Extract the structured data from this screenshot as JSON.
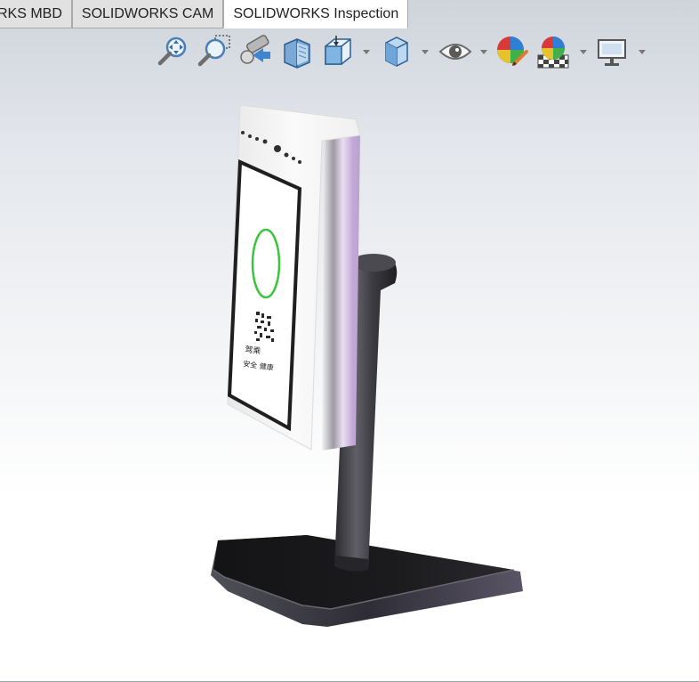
{
  "tabs": [
    {
      "label": "RKS MBD",
      "active": false
    },
    {
      "label": "SOLIDWORKS CAM",
      "active": false
    },
    {
      "label": "SOLIDWORKS Inspection",
      "active": true
    }
  ],
  "toolbar": {
    "icons": [
      "zoom-to-fit-icon",
      "zoom-to-area-icon",
      "previous-view-icon",
      "section-view-icon",
      "view-orientation-icon",
      "display-style-icon",
      "hide-show-items-icon",
      "edit-appearance-icon",
      "apply-scene-icon",
      "view-settings-icon"
    ]
  },
  "screen": {
    "qr_caption_line1": "驾乘",
    "qr_caption_line2": "安全 健康"
  },
  "colors": {
    "accent_green": "#3cc43c",
    "stand_dark": "#3a3a3f",
    "device_body": "#f4f4f4",
    "device_edge": "#c9b7d8"
  }
}
